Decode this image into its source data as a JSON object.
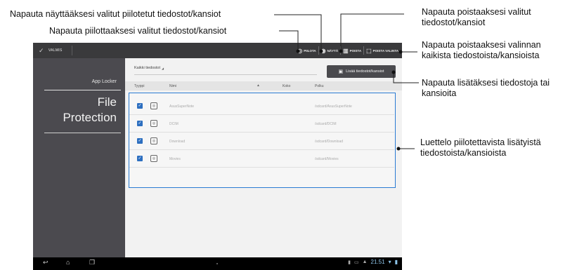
{
  "callouts": {
    "show_hidden": "Napauta näyttääksesi valitut piilotetut tiedostot/kansiot",
    "hide_selected": "Napauta piilottaaksesi valitut tiedostot/kansiot",
    "remove_selected_line1": "Napauta poistaaksesi valitut",
    "remove_selected_line2": "tiedostot/kansiot",
    "clear_selection_line1": "Napauta poistaaksesi valinnan",
    "clear_selection_line2": "kaikista tiedostoista/kansioista",
    "add_files_line1": "Napauta lisätäksesi tiedostoja tai",
    "add_files_line2": "kansioita",
    "list_desc_line1": "Luettelo piilotettavista lisätyistä",
    "list_desc_line2": "tiedostoista/kansioista"
  },
  "actionbar": {
    "done_label": "VALMIS",
    "hide_label": "PIILOTA",
    "show_label": "NÄYTÄ",
    "remove_label": "POISTA",
    "clear_label": "POISTA VALINTA"
  },
  "sidebar": {
    "subtitle": "App Locker",
    "title_line1": "File",
    "title_line2": "Protection"
  },
  "main": {
    "filter_label": "Kaikki tiedostot",
    "add_button": "Lisää tiedostot/kansiot",
    "columns": {
      "type": "Tyyppi",
      "name": "Nimi",
      "size": "Koko",
      "path": "Polku"
    },
    "rows": [
      {
        "name": "AsusSuperNote",
        "path": "/sdcard/AsusSuperNote"
      },
      {
        "name": "DCIM",
        "path": "/sdcard/DCIM"
      },
      {
        "name": "Download",
        "path": "/sdcard/Download"
      },
      {
        "name": "Movies",
        "path": "/sdcard/Movies"
      }
    ]
  },
  "statusbar": {
    "time": "21.51"
  },
  "colors": {
    "actionbar": "#3a3a3c",
    "sidebar": "#4b4a4f",
    "highlight": "#2a7bd3",
    "checkbox": "#2d6fc0"
  }
}
